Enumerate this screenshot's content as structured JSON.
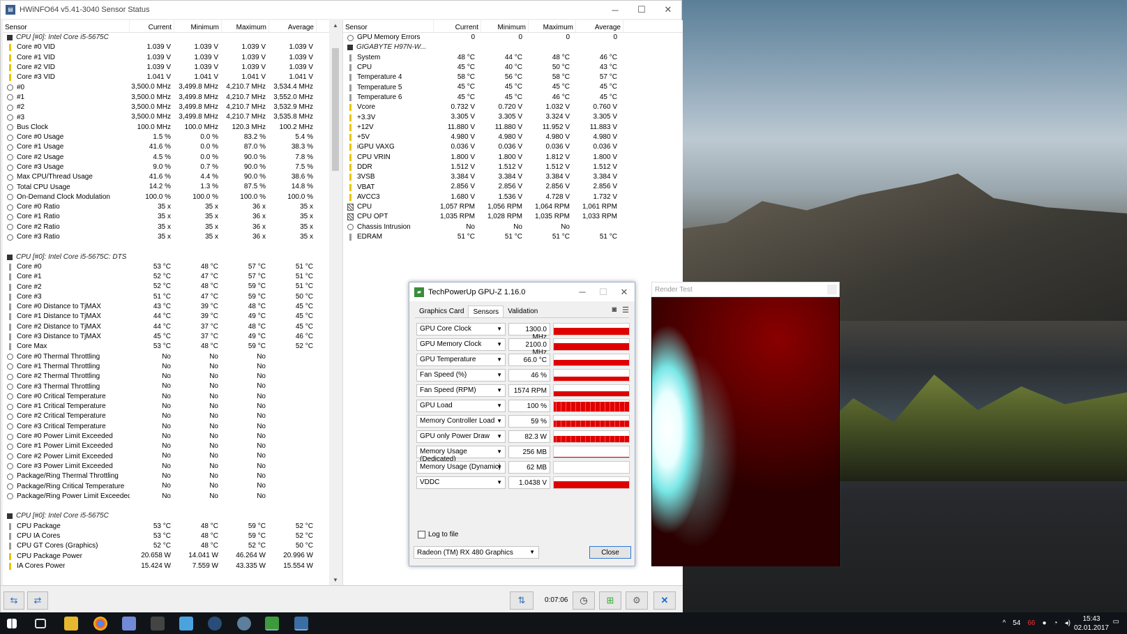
{
  "hwinfo": {
    "title": "HWiNFO64 v5.41-3040 Sensor Status",
    "cols": [
      "Sensor",
      "Current",
      "Minimum",
      "Maximum",
      "Average"
    ],
    "left_rows": [
      {
        "t": "g",
        "n": "CPU [#0]: Intel Core i5-5675C"
      },
      {
        "t": "v",
        "n": "Core #0 VID",
        "c": "1.039 V",
        "mi": "1.039 V",
        "ma": "1.039 V",
        "a": "1.039 V"
      },
      {
        "t": "v",
        "n": "Core #1 VID",
        "c": "1.039 V",
        "mi": "1.039 V",
        "ma": "1.039 V",
        "a": "1.039 V"
      },
      {
        "t": "v",
        "n": "Core #2 VID",
        "c": "1.039 V",
        "mi": "1.039 V",
        "ma": "1.039 V",
        "a": "1.039 V"
      },
      {
        "t": "v",
        "n": "Core #3 VID",
        "c": "1.041 V",
        "mi": "1.041 V",
        "ma": "1.041 V",
        "a": "1.041 V"
      },
      {
        "t": "c",
        "n": "#0",
        "c": "3,500.0 MHz",
        "mi": "3,499.8 MHz",
        "ma": "4,210.7 MHz",
        "a": "3,534.4 MHz"
      },
      {
        "t": "c",
        "n": "#1",
        "c": "3,500.0 MHz",
        "mi": "3,499.8 MHz",
        "ma": "4,210.7 MHz",
        "a": "3,552.0 MHz"
      },
      {
        "t": "c",
        "n": "#2",
        "c": "3,500.0 MHz",
        "mi": "3,499.8 MHz",
        "ma": "4,210.7 MHz",
        "a": "3,532.9 MHz"
      },
      {
        "t": "c",
        "n": "#3",
        "c": "3,500.0 MHz",
        "mi": "3,499.8 MHz",
        "ma": "4,210.7 MHz",
        "a": "3,535.8 MHz"
      },
      {
        "t": "c",
        "n": "Bus Clock",
        "c": "100.0 MHz",
        "mi": "100.0 MHz",
        "ma": "120.3 MHz",
        "a": "100.2 MHz"
      },
      {
        "t": "c",
        "n": "Core #0 Usage",
        "c": "1.5 %",
        "mi": "0.0 %",
        "ma": "83.2 %",
        "a": "5.4 %"
      },
      {
        "t": "c",
        "n": "Core #1 Usage",
        "c": "41.6 %",
        "mi": "0.0 %",
        "ma": "87.0 %",
        "a": "38.3 %"
      },
      {
        "t": "c",
        "n": "Core #2 Usage",
        "c": "4.5 %",
        "mi": "0.0 %",
        "ma": "90.0 %",
        "a": "7.8 %"
      },
      {
        "t": "c",
        "n": "Core #3 Usage",
        "c": "9.0 %",
        "mi": "0.7 %",
        "ma": "90.0 %",
        "a": "7.5 %"
      },
      {
        "t": "c",
        "n": "Max CPU/Thread Usage",
        "c": "41.6 %",
        "mi": "4.4 %",
        "ma": "90.0 %",
        "a": "38.6 %"
      },
      {
        "t": "c",
        "n": "Total CPU Usage",
        "c": "14.2 %",
        "mi": "1.3 %",
        "ma": "87.5 %",
        "a": "14.8 %"
      },
      {
        "t": "c",
        "n": "On-Demand Clock Modulation",
        "c": "100.0 %",
        "mi": "100.0 %",
        "ma": "100.0 %",
        "a": "100.0 %"
      },
      {
        "t": "c",
        "n": "Core #0 Ratio",
        "c": "35 x",
        "mi": "35 x",
        "ma": "36 x",
        "a": "35 x"
      },
      {
        "t": "c",
        "n": "Core #1 Ratio",
        "c": "35 x",
        "mi": "35 x",
        "ma": "36 x",
        "a": "35 x"
      },
      {
        "t": "c",
        "n": "Core #2 Ratio",
        "c": "35 x",
        "mi": "35 x",
        "ma": "36 x",
        "a": "35 x"
      },
      {
        "t": "c",
        "n": "Core #3 Ratio",
        "c": "35 x",
        "mi": "35 x",
        "ma": "36 x",
        "a": "35 x"
      },
      {
        "t": "b",
        "n": ""
      },
      {
        "t": "g",
        "n": "CPU [#0]: Intel Core i5-5675C: DTS"
      },
      {
        "t": "t",
        "n": "Core #0",
        "c": "53 °C",
        "mi": "48 °C",
        "ma": "57 °C",
        "a": "51 °C"
      },
      {
        "t": "t",
        "n": "Core #1",
        "c": "52 °C",
        "mi": "47 °C",
        "ma": "57 °C",
        "a": "51 °C"
      },
      {
        "t": "t",
        "n": "Core #2",
        "c": "52 °C",
        "mi": "48 °C",
        "ma": "59 °C",
        "a": "51 °C"
      },
      {
        "t": "t",
        "n": "Core #3",
        "c": "51 °C",
        "mi": "47 °C",
        "ma": "59 °C",
        "a": "50 °C"
      },
      {
        "t": "t",
        "n": "Core #0 Distance to TjMAX",
        "c": "43 °C",
        "mi": "39 °C",
        "ma": "48 °C",
        "a": "45 °C"
      },
      {
        "t": "t",
        "n": "Core #1 Distance to TjMAX",
        "c": "44 °C",
        "mi": "39 °C",
        "ma": "49 °C",
        "a": "45 °C"
      },
      {
        "t": "t",
        "n": "Core #2 Distance to TjMAX",
        "c": "44 °C",
        "mi": "37 °C",
        "ma": "48 °C",
        "a": "45 °C"
      },
      {
        "t": "t",
        "n": "Core #3 Distance to TjMAX",
        "c": "45 °C",
        "mi": "37 °C",
        "ma": "49 °C",
        "a": "46 °C"
      },
      {
        "t": "t",
        "n": "Core Max",
        "c": "53 °C",
        "mi": "48 °C",
        "ma": "59 °C",
        "a": "52 °C"
      },
      {
        "t": "c",
        "n": "Core #0 Thermal Throttling",
        "c": "No",
        "mi": "No",
        "ma": "No",
        "a": ""
      },
      {
        "t": "c",
        "n": "Core #1 Thermal Throttling",
        "c": "No",
        "mi": "No",
        "ma": "No",
        "a": ""
      },
      {
        "t": "c",
        "n": "Core #2 Thermal Throttling",
        "c": "No",
        "mi": "No",
        "ma": "No",
        "a": ""
      },
      {
        "t": "c",
        "n": "Core #3 Thermal Throttling",
        "c": "No",
        "mi": "No",
        "ma": "No",
        "a": ""
      },
      {
        "t": "c",
        "n": "Core #0 Critical Temperature",
        "c": "No",
        "mi": "No",
        "ma": "No",
        "a": ""
      },
      {
        "t": "c",
        "n": "Core #1 Critical Temperature",
        "c": "No",
        "mi": "No",
        "ma": "No",
        "a": ""
      },
      {
        "t": "c",
        "n": "Core #2 Critical Temperature",
        "c": "No",
        "mi": "No",
        "ma": "No",
        "a": ""
      },
      {
        "t": "c",
        "n": "Core #3 Critical Temperature",
        "c": "No",
        "mi": "No",
        "ma": "No",
        "a": ""
      },
      {
        "t": "c",
        "n": "Core #0 Power Limit Exceeded",
        "c": "No",
        "mi": "No",
        "ma": "No",
        "a": ""
      },
      {
        "t": "c",
        "n": "Core #1 Power Limit Exceeded",
        "c": "No",
        "mi": "No",
        "ma": "No",
        "a": ""
      },
      {
        "t": "c",
        "n": "Core #2 Power Limit Exceeded",
        "c": "No",
        "mi": "No",
        "ma": "No",
        "a": ""
      },
      {
        "t": "c",
        "n": "Core #3 Power Limit Exceeded",
        "c": "No",
        "mi": "No",
        "ma": "No",
        "a": ""
      },
      {
        "t": "c",
        "n": "Package/Ring Thermal Throttling",
        "c": "No",
        "mi": "No",
        "ma": "No",
        "a": ""
      },
      {
        "t": "c",
        "n": "Package/Ring Critical Temperature",
        "c": "No",
        "mi": "No",
        "ma": "No",
        "a": ""
      },
      {
        "t": "c",
        "n": "Package/Ring Power Limit Exceeded",
        "c": "No",
        "mi": "No",
        "ma": "No",
        "a": ""
      },
      {
        "t": "b",
        "n": ""
      },
      {
        "t": "g",
        "n": "CPU [#0]: Intel Core i5-5675C"
      },
      {
        "t": "t",
        "n": "CPU Package",
        "c": "53 °C",
        "mi": "48 °C",
        "ma": "59 °C",
        "a": "52 °C"
      },
      {
        "t": "t",
        "n": "CPU IA Cores",
        "c": "53 °C",
        "mi": "48 °C",
        "ma": "59 °C",
        "a": "52 °C"
      },
      {
        "t": "t",
        "n": "CPU GT Cores (Graphics)",
        "c": "52 °C",
        "mi": "48 °C",
        "ma": "52 °C",
        "a": "50 °C"
      },
      {
        "t": "v",
        "n": "CPU Package Power",
        "c": "20.658 W",
        "mi": "14.041 W",
        "ma": "46.264 W",
        "a": "20.996 W"
      },
      {
        "t": "v",
        "n": "IA Cores Power",
        "c": "15.424 W",
        "mi": "7.559 W",
        "ma": "43.335 W",
        "a": "15.554 W"
      }
    ],
    "right_rows": [
      {
        "t": "c",
        "n": "GPU Memory Errors",
        "c": "0",
        "mi": "0",
        "ma": "0",
        "a": "0"
      },
      {
        "t": "g",
        "n": "GIGABYTE H97N-W..."
      },
      {
        "t": "t",
        "n": "System",
        "c": "48 °C",
        "mi": "44 °C",
        "ma": "48 °C",
        "a": "46 °C"
      },
      {
        "t": "t",
        "n": "CPU",
        "c": "45 °C",
        "mi": "40 °C",
        "ma": "50 °C",
        "a": "43 °C"
      },
      {
        "t": "t",
        "n": "Temperature 4",
        "c": "58 °C",
        "mi": "56 °C",
        "ma": "58 °C",
        "a": "57 °C"
      },
      {
        "t": "t",
        "n": "Temperature 5",
        "c": "45 °C",
        "mi": "45 °C",
        "ma": "45 °C",
        "a": "45 °C"
      },
      {
        "t": "t",
        "n": "Temperature 6",
        "c": "45 °C",
        "mi": "45 °C",
        "ma": "46 °C",
        "a": "45 °C"
      },
      {
        "t": "v",
        "n": "Vcore",
        "c": "0.732 V",
        "mi": "0.720 V",
        "ma": "1.032 V",
        "a": "0.760 V"
      },
      {
        "t": "v",
        "n": "+3.3V",
        "c": "3.305 V",
        "mi": "3.305 V",
        "ma": "3.324 V",
        "a": "3.305 V"
      },
      {
        "t": "v",
        "n": "+12V",
        "c": "11.880 V",
        "mi": "11.880 V",
        "ma": "11.952 V",
        "a": "11.883 V"
      },
      {
        "t": "v",
        "n": "+5V",
        "c": "4.980 V",
        "mi": "4.980 V",
        "ma": "4.980 V",
        "a": "4.980 V"
      },
      {
        "t": "v",
        "n": "iGPU VAXG",
        "c": "0.036 V",
        "mi": "0.036 V",
        "ma": "0.036 V",
        "a": "0.036 V"
      },
      {
        "t": "v",
        "n": "CPU VRIN",
        "c": "1.800 V",
        "mi": "1.800 V",
        "ma": "1.812 V",
        "a": "1.800 V"
      },
      {
        "t": "v",
        "n": "DDR",
        "c": "1.512 V",
        "mi": "1.512 V",
        "ma": "1.512 V",
        "a": "1.512 V"
      },
      {
        "t": "v",
        "n": "3VSB",
        "c": "3.384 V",
        "mi": "3.384 V",
        "ma": "3.384 V",
        "a": "3.384 V"
      },
      {
        "t": "v",
        "n": "VBAT",
        "c": "2.856 V",
        "mi": "2.856 V",
        "ma": "2.856 V",
        "a": "2.856 V"
      },
      {
        "t": "v",
        "n": "AVCC3",
        "c": "1.680 V",
        "mi": "1.536 V",
        "ma": "4.728 V",
        "a": "1.732 V"
      },
      {
        "t": "f",
        "n": "CPU",
        "c": "1,057 RPM",
        "mi": "1,056 RPM",
        "ma": "1,064 RPM",
        "a": "1,061 RPM"
      },
      {
        "t": "f",
        "n": "CPU OPT",
        "c": "1,035 RPM",
        "mi": "1,028 RPM",
        "ma": "1,035 RPM",
        "a": "1,033 RPM"
      },
      {
        "t": "c",
        "n": "Chassis Intrusion",
        "c": "No",
        "mi": "No",
        "ma": "No",
        "a": ""
      },
      {
        "t": "t",
        "n": "EDRAM",
        "c": "51 °C",
        "mi": "51 °C",
        "ma": "51 °C",
        "a": "51 °C"
      }
    ],
    "timer": "0:07:06"
  },
  "gpuz": {
    "title": "TechPowerUp GPU-Z 1.16.0",
    "tabs": [
      "Graphics Card",
      "Sensors",
      "Validation"
    ],
    "active_tab": "Sensors",
    "sensors": [
      {
        "name": "GPU Core Clock",
        "value": "1300.0 MHz",
        "level": 0.62,
        "noisy": false
      },
      {
        "name": "GPU Memory Clock",
        "value": "2100.0 MHz",
        "level": 0.62,
        "noisy": false
      },
      {
        "name": "GPU Temperature",
        "value": "66.0 °C",
        "level": 0.5,
        "noisy": false
      },
      {
        "name": "Fan Speed (%)",
        "value": "46 %",
        "level": 0.4,
        "noisy": false
      },
      {
        "name": "Fan Speed (RPM)",
        "value": "1574 RPM",
        "level": 0.45,
        "noisy": false
      },
      {
        "name": "GPU Load",
        "value": "100 %",
        "level": 0.9,
        "noisy": true
      },
      {
        "name": "Memory Controller Load",
        "value": "59 %",
        "level": 0.55,
        "noisy": true
      },
      {
        "name": "GPU only Power Draw",
        "value": "82.3 W",
        "level": 0.55,
        "noisy": true
      },
      {
        "name": "Memory Usage (Dedicated)",
        "value": "256 MB",
        "level": 0.05,
        "noisy": false
      },
      {
        "name": "Memory Usage (Dynamic)",
        "value": "62 MB",
        "level": 0.02,
        "noisy": false
      },
      {
        "name": "VDDC",
        "value": "1.0438 V",
        "level": 0.62,
        "noisy": false
      }
    ],
    "log_label": "Log to file",
    "device": "Radeon (TM) RX 480 Graphics",
    "close_label": "Close"
  },
  "render_test": {
    "title": "Render Test"
  },
  "taskbar": {
    "tray_temp_1": "54",
    "tray_temp_2": "66",
    "time": "15:43",
    "date": "02.01.2017"
  },
  "colors": {
    "graph": "#e00000",
    "accent": "#2c78d8"
  }
}
